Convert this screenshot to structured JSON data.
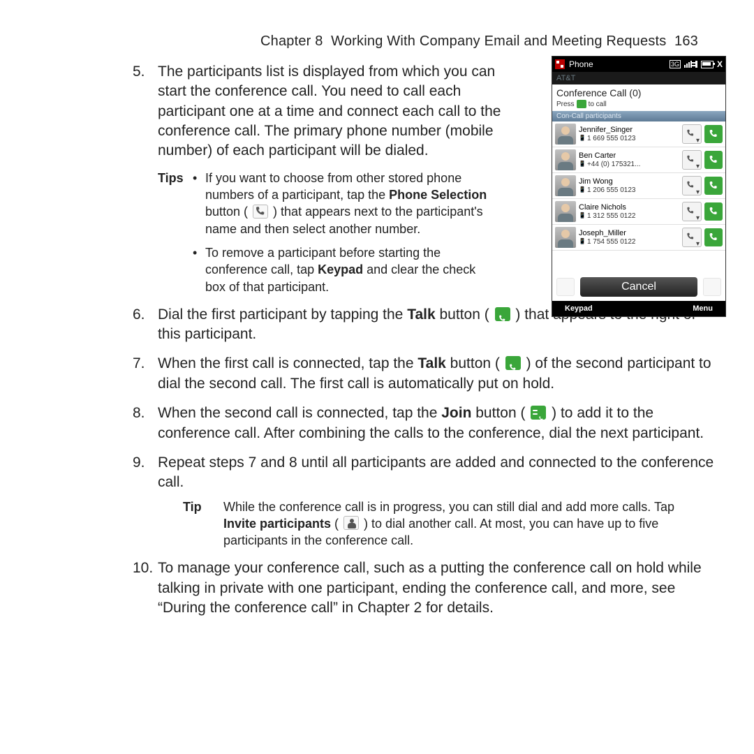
{
  "header": {
    "chapter_label": "Chapter 8",
    "chapter_title": "Working With Company Email and Meeting Requests",
    "page_number": "163"
  },
  "steps": {
    "s5": {
      "num": "5.",
      "text": "The participants list is displayed from which you can start the conference call. You need to call each participant one at a time and connect each call to the conference call. The primary phone number (mobile number) of each participant will be dialed."
    },
    "s5_tips_label": "Tips",
    "s5_tip1_a": "If you want to choose from other stored phone numbers of a participant, tap the ",
    "s5_tip1_bold": "Phone Selection",
    "s5_tip1_b": " button ( ",
    "s5_tip1_c": " ) that appears next to the participant's name and then select another number.",
    "s5_tip2_a": "To remove a participant before starting the conference call, tap ",
    "s5_tip2_bold": "Keypad",
    "s5_tip2_b": " and clear the check box of that participant.",
    "s6": {
      "num": "6.",
      "a": "Dial the first participant by tapping the ",
      "bold": "Talk",
      "b": " button ( ",
      "c": " ) that appears to the right of this participant."
    },
    "s7": {
      "num": "7.",
      "a": "When the first call is connected, tap the ",
      "bold": "Talk",
      "b": " button ( ",
      "c": " ) of the second participant to dial the second call. The first call is automatically put on hold."
    },
    "s8": {
      "num": "8.",
      "a": "When the second call is connected, tap the ",
      "bold": "Join",
      "b": " button ( ",
      "c": " ) to add it to the conference call. After combining the calls to the conference, dial the next participant."
    },
    "s9": {
      "num": "9.",
      "text": "Repeat steps 7 and 8 until all participants are added and connected to the conference call."
    },
    "s9_tip_label": "Tip",
    "s9_tip_a": "While the conference call is in progress, you can still dial and add more calls. Tap ",
    "s9_tip_bold": "Invite participants",
    "s9_tip_b": " ( ",
    "s9_tip_c": " ) to dial another call. At most, you can have up to five participants in the conference call.",
    "s10": {
      "num": "10.",
      "text": "To manage your conference call, such as a putting the conference call on hold while talking in private with one participant, ending the conference call, and more, see “During the conference call” in Chapter 2 for details."
    }
  },
  "phone": {
    "title": "Phone",
    "carrier": "AT&T",
    "header": "Conference Call (0)",
    "subline_a": "Press",
    "subline_b": "to call",
    "section": "Con-Call participants",
    "participants": [
      {
        "name": "Jennifer_Singer",
        "num": "1 669 555 0123"
      },
      {
        "name": "Ben Carter",
        "num": "+44 (0) 175321..."
      },
      {
        "name": "Jim Wong",
        "num": "1 206 555 0123"
      },
      {
        "name": "Claire Nichols",
        "num": "1 312 555 0122"
      },
      {
        "name": "Joseph_Miller",
        "num": "1 754 555 0122"
      }
    ],
    "cancel": "Cancel",
    "soft_left": "Keypad",
    "soft_right": "Menu",
    "close_x": "X"
  }
}
